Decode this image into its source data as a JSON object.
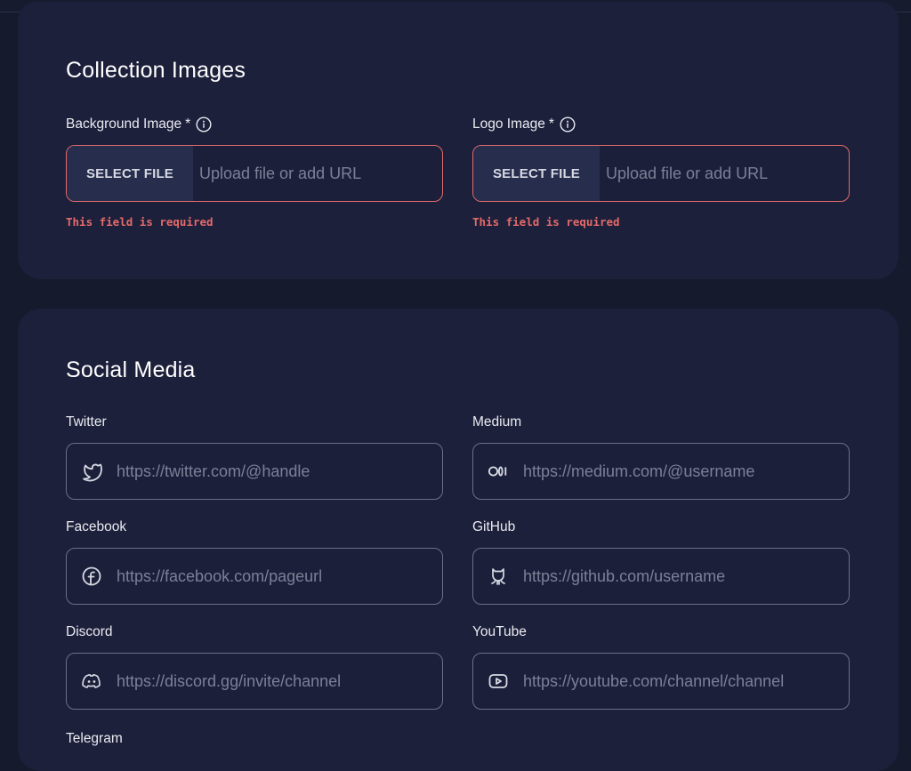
{
  "collection_images": {
    "title": "Collection Images",
    "fields": [
      {
        "label": "Background Image",
        "required_marker": "*",
        "button_label": "SELECT FILE",
        "placeholder": "Upload file or add URL",
        "value": "",
        "error": "This field is required"
      },
      {
        "label": "Logo Image",
        "required_marker": "*",
        "button_label": "SELECT FILE",
        "placeholder": "Upload file or add URL",
        "value": "",
        "error": "This field is required"
      }
    ]
  },
  "social_media": {
    "title": "Social Media",
    "fields": [
      {
        "label": "Twitter",
        "icon": "twitter-icon",
        "placeholder": "https://twitter.com/@handle",
        "value": ""
      },
      {
        "label": "Medium",
        "icon": "medium-icon",
        "placeholder": "https://medium.com/@username",
        "value": ""
      },
      {
        "label": "Facebook",
        "icon": "facebook-icon",
        "placeholder": "https://facebook.com/pageurl",
        "value": ""
      },
      {
        "label": "GitHub",
        "icon": "github-icon",
        "placeholder": "https://github.com/username",
        "value": ""
      },
      {
        "label": "Discord",
        "icon": "discord-icon",
        "placeholder": "https://discord.gg/invite/channel",
        "value": ""
      },
      {
        "label": "YouTube",
        "icon": "youtube-icon",
        "placeholder": "https://youtube.com/channel/channel",
        "value": ""
      },
      {
        "label": "Telegram",
        "icon": "telegram-icon"
      }
    ]
  },
  "colors": {
    "page_bg": "#161a2d",
    "card_bg": "#1d203b",
    "error": "#e46a6a",
    "input_border": "#6b6f85",
    "button_bg": "#262d4d"
  }
}
